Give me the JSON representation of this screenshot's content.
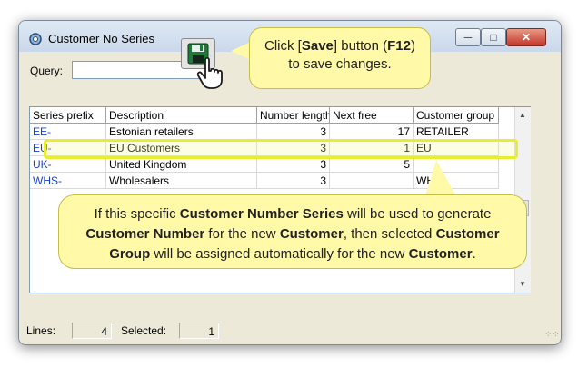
{
  "window": {
    "title": "Customer No Series"
  },
  "query": {
    "label": "Query:",
    "value": ""
  },
  "grid": {
    "columns": [
      "Series prefix",
      "Description",
      "Number length",
      "Next free",
      "Customer group"
    ],
    "rows": [
      {
        "prefix": "EE-",
        "description": "Estonian retailers",
        "length": "3",
        "next_free": "17",
        "group": "RETAILER"
      },
      {
        "prefix": "EU-",
        "description": "EU Customers",
        "length": "3",
        "next_free": "1",
        "group": "EU"
      },
      {
        "prefix": "UK-",
        "description": "United Kingdom",
        "length": "3",
        "next_free": "5",
        "group": ""
      },
      {
        "prefix": "WHS-",
        "description": "Wholesalers",
        "length": "3",
        "next_free": "",
        "group": "WHS"
      }
    ]
  },
  "status": {
    "lines_label": "Lines:",
    "lines_value": "4",
    "selected_label": "Selected:",
    "selected_value": "1"
  },
  "tips": {
    "save": {
      "t1": "Click [",
      "t2": "Save",
      "t3": "] button (",
      "t4": "F12",
      "t5": ")",
      "t6": "to save changes."
    },
    "group": {
      "p1": "If this specific ",
      "b1": "Customer Number Series",
      "p2": " will be used to generate",
      "b2": "Customer Number",
      "p3": " for the new ",
      "b3": "Customer",
      "p4": ", then selected ",
      "b4": "Customer",
      "b5": "Group",
      "p5": " will be assigned automatically for the new ",
      "b6": "Customer",
      "p6": "."
    }
  },
  "colors": {
    "accent_highlight": "#e8ec33",
    "callout_bg": "#fff9a8",
    "prefix_link": "#1a3fcf"
  }
}
